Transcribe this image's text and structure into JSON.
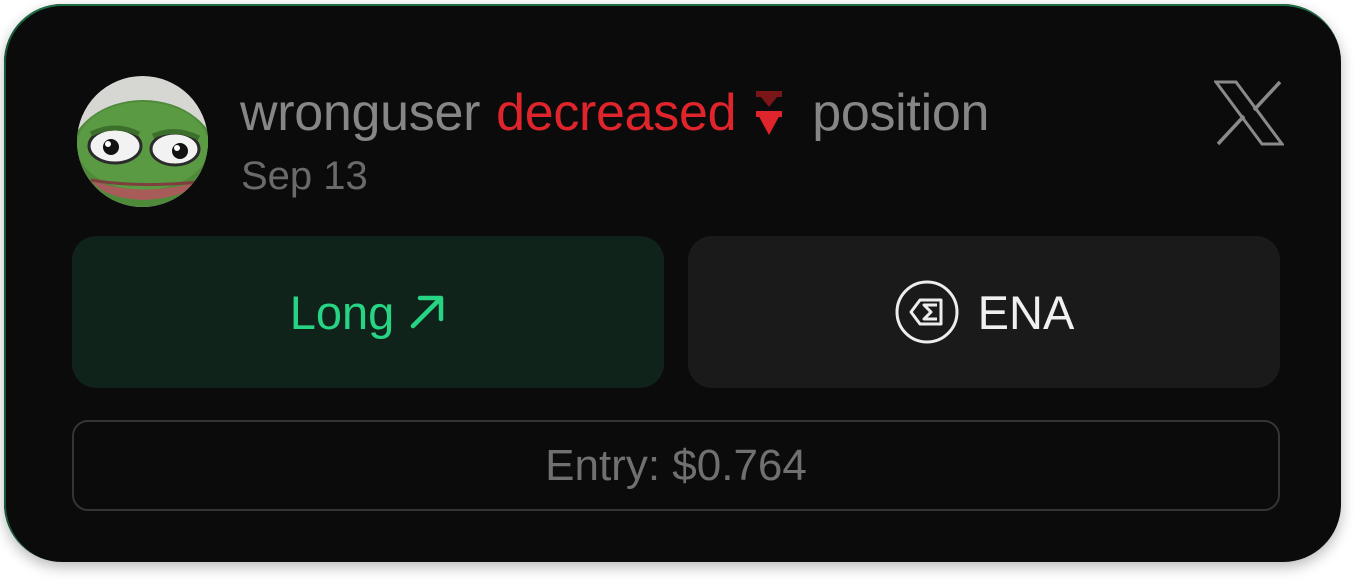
{
  "colors": {
    "card_background": "#0b0b0b",
    "decreased_red": "#e0242b",
    "long_green": "#27d483",
    "long_button_bg": "#0f231a",
    "token_button_bg": "#1a1a1a",
    "muted_text": "#868686"
  },
  "header": {
    "avatar_icon": "pepe-frog-avatar",
    "username": "wronguser",
    "action": "decreased",
    "action_icon": "double-down-arrow-icon",
    "object": "position",
    "date": "Sep 13",
    "platform_icon": "x-logo-icon"
  },
  "trade": {
    "direction_label": "Long",
    "direction_icon": "arrow-up-right-icon",
    "token_icon": "ena-token-icon",
    "token_symbol": "ENA"
  },
  "entry": {
    "label": "Entry:",
    "value": "$0.764"
  }
}
